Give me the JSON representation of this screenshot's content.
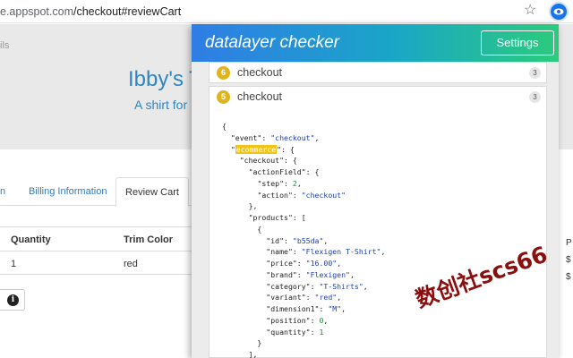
{
  "browser": {
    "url_host": "e.appspot.com",
    "url_path": "/checkout#reviewCart",
    "star_icon": "star-icon",
    "extension_icon": "datalayer-extension-icon"
  },
  "page": {
    "hero_fragment": "ils",
    "hero_title": "Ibby's T",
    "hero_subtitle": "A shirt for l",
    "tabs": {
      "fragment": "n",
      "billing": "Billing Information",
      "review": "Review Cart"
    },
    "table": {
      "headers": [
        "Quantity",
        "Trim Color"
      ],
      "rows": [
        [
          "1",
          "red"
        ]
      ]
    },
    "info_glyph": "i",
    "right_fragments": [
      "P",
      "$",
      "$"
    ]
  },
  "popup": {
    "title": "datalayer checker",
    "settings_label": "Settings",
    "events": [
      {
        "index": "6",
        "name": "checkout",
        "count": "3"
      },
      {
        "index": "5",
        "name": "checkout",
        "count": "3"
      }
    ],
    "code_lines": [
      "{",
      "  \"event\": \"checkout\",",
      "  \"ecommerce\": {",
      "    \"checkout\": {",
      "      \"actionField\": {",
      "        \"step\": 2,",
      "        \"action\": \"checkout\"",
      "      },",
      "      \"products\": [",
      "        {",
      "          \"id\": \"b55da\",",
      "          \"name\": \"Flexigen T-Shirt\",",
      "          \"price\": \"16.00\",",
      "          \"brand\": \"Flexigen\",",
      "          \"category\": \"T-Shirts\",",
      "          \"variant\": \"red\",",
      "          \"dimension1\": \"M\",",
      "          \"position\": 0,",
      "          \"quantity\": 1",
      "        }",
      "      ],"
    ],
    "highlight_key": "ecommerce"
  },
  "watermark": "数创社scs66",
  "colors": {
    "header_gradient_start": "#2f7de6",
    "header_gradient_end": "#2ccb7c",
    "badge": "#e0b41e",
    "highlight": "#f0c419",
    "link": "#337ab7",
    "watermark": "#8b0f0f"
  }
}
